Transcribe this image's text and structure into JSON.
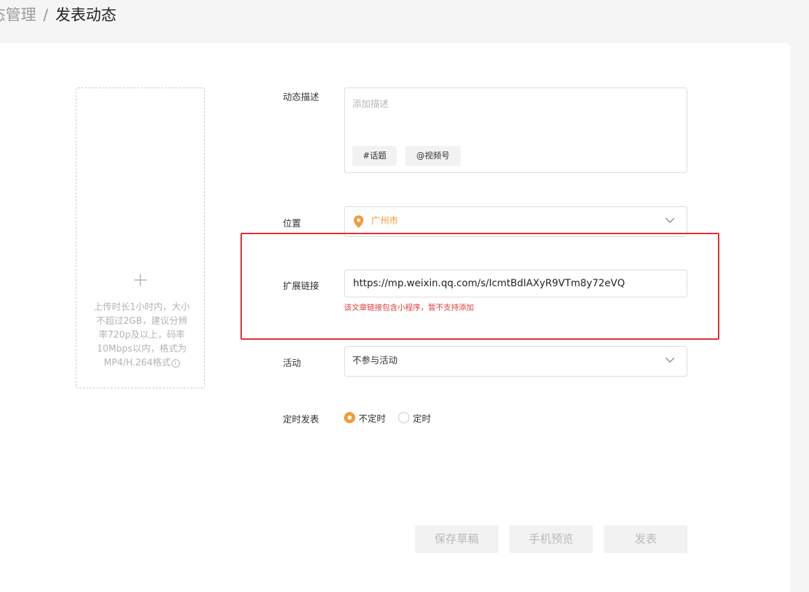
{
  "breadcrumb": {
    "previous": "态管理",
    "separator": "/",
    "current": "发表动态"
  },
  "upload": {
    "plus_icon": "plus-icon",
    "hint": "上传时长1小时内，大小不超过2GB，建议分辨率720p及以上，码率10Mbps以内，格式为MP4/H.264格式",
    "info_icon_glyph": "i"
  },
  "form": {
    "description": {
      "label": "动态描述",
      "placeholder": "添加描述",
      "topic_button": "#话题",
      "mention_button": "@视频号"
    },
    "location": {
      "label": "位置",
      "value": "广州市",
      "accent_color": "#f29b38"
    },
    "link": {
      "label": "扩展链接",
      "value": "https://mp.weixin.qq.com/s/IcmtBdIAXyR9VTm8y72eVQ",
      "error": "该文章链接包含小程序，暂不支持添加",
      "error_color": "#e53a3a"
    },
    "activity": {
      "label": "活动",
      "value": "不参与活动"
    },
    "schedule": {
      "label": "定时发表",
      "options": [
        {
          "label": "不定时",
          "checked": true
        },
        {
          "label": "定时",
          "checked": false
        }
      ]
    }
  },
  "actions": {
    "save_draft": "保存草稿",
    "preview": "手机预览",
    "publish": "发表"
  }
}
